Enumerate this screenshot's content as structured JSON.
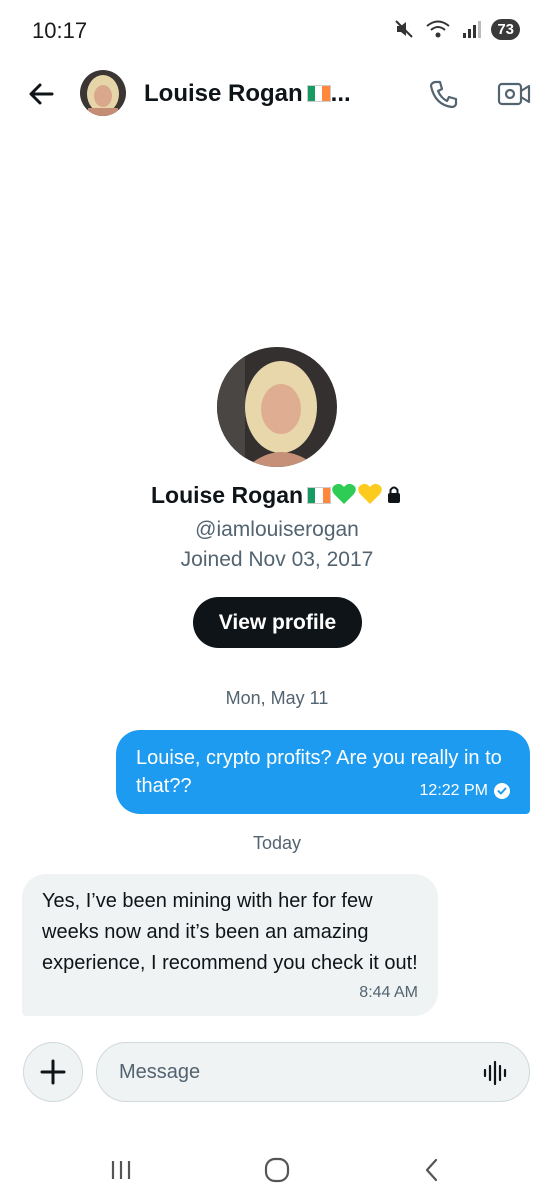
{
  "status_bar": {
    "time": "10:17",
    "battery": "73"
  },
  "header": {
    "contact_name": "Louise Rogan",
    "truncation": "..."
  },
  "profile": {
    "name": "Louise Rogan",
    "handle": "@iamlouiserogan",
    "joined": "Joined Nov 03, 2017",
    "view_profile_label": "View profile"
  },
  "conversation": {
    "date_separators": [
      "Mon, May 11",
      "Today"
    ],
    "messages": [
      {
        "direction": "outgoing",
        "text": "Louise, crypto profits? Are you really in to that??",
        "time": "12:22 PM"
      },
      {
        "direction": "incoming",
        "text": "Yes, I’ve been mining with her for few weeks now and it’s been an amazing experience, I recommend you check it out!",
        "time": "8:44 AM"
      }
    ]
  },
  "composer": {
    "placeholder": "Message"
  },
  "colors": {
    "accent": "#1d9bf0",
    "incoming_bubble": "#eff3f4",
    "text_secondary": "#536471",
    "button_dark": "#0f1419"
  },
  "icons": [
    "back-arrow-icon",
    "phone-icon",
    "video-call-icon",
    "plus-icon",
    "voice-wave-icon",
    "lock-icon",
    "sent-check-icon",
    "recents-icon",
    "home-icon",
    "back-icon"
  ]
}
